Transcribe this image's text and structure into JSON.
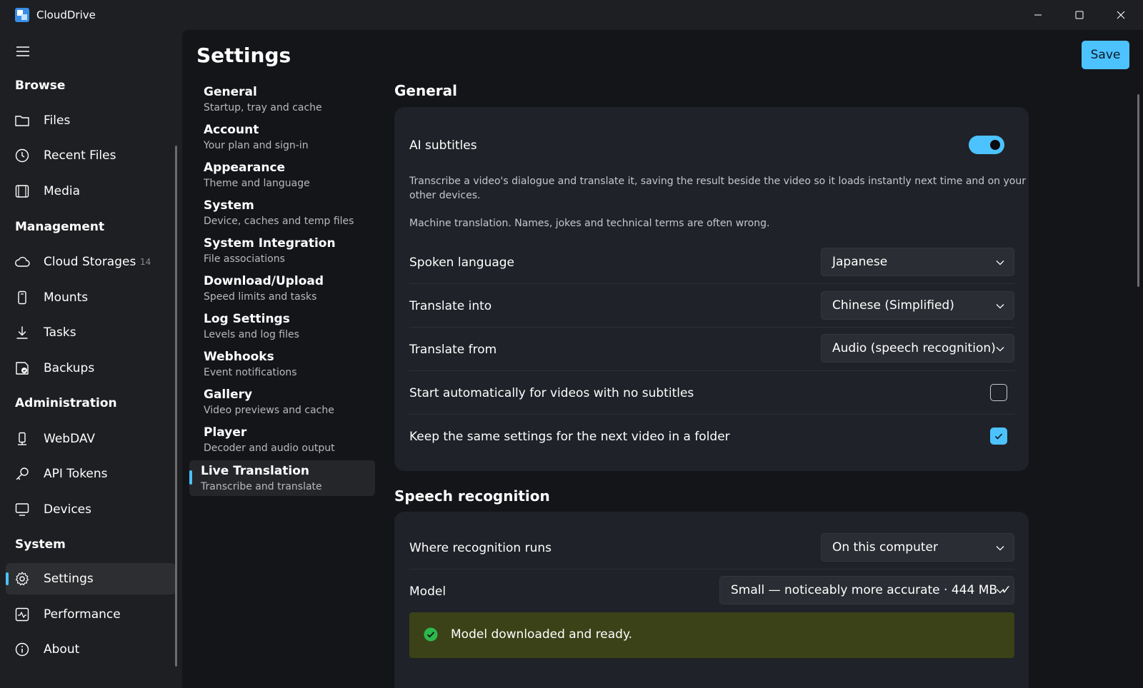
{
  "window": {
    "title": "CloudDrive",
    "controls": {
      "minimize": "minimize-icon",
      "maximize": "maximize-icon",
      "close": "close-icon"
    }
  },
  "colors": {
    "accent": "#4cc2ff",
    "banner_bg": "#3c4217",
    "success": "#2db84d"
  },
  "nav": {
    "sections": {
      "browse": "Browse",
      "management": "Management",
      "administration": "Administration",
      "system": "System"
    },
    "items": {
      "files": {
        "label": "Files",
        "icon": "folder-icon"
      },
      "recent": {
        "label": "Recent Files",
        "icon": "clock-icon"
      },
      "media": {
        "label": "Media",
        "icon": "film-icon"
      },
      "cloud": {
        "label": "Cloud Storages",
        "icon": "cloud-icon",
        "badge": "14"
      },
      "mounts": {
        "label": "Mounts",
        "icon": "drive-icon"
      },
      "tasks": {
        "label": "Tasks",
        "icon": "download-icon"
      },
      "backups": {
        "label": "Backups",
        "icon": "backup-icon"
      },
      "webdav": {
        "label": "WebDAV",
        "icon": "server-icon"
      },
      "tokens": {
        "label": "API Tokens",
        "icon": "key-icon"
      },
      "devices": {
        "label": "Devices",
        "icon": "monitor-icon"
      },
      "settings": {
        "label": "Settings",
        "icon": "gear-icon"
      },
      "performance": {
        "label": "Performance",
        "icon": "chart-icon"
      },
      "about": {
        "label": "About",
        "icon": "info-icon"
      }
    }
  },
  "page": {
    "title": "Settings",
    "save_label": "Save"
  },
  "subnav": [
    {
      "title": "General",
      "desc": "Startup, tray and cache"
    },
    {
      "title": "Account",
      "desc": "Your plan and sign-in"
    },
    {
      "title": "Appearance",
      "desc": "Theme and language"
    },
    {
      "title": "System",
      "desc": "Device, caches and temp files"
    },
    {
      "title": "System Integration",
      "desc": "File associations"
    },
    {
      "title": "Download/Upload",
      "desc": "Speed limits and tasks"
    },
    {
      "title": "Log Settings",
      "desc": "Levels and log files"
    },
    {
      "title": "Webhooks",
      "desc": "Event notifications"
    },
    {
      "title": "Gallery",
      "desc": "Video previews and cache"
    },
    {
      "title": "Player",
      "desc": "Decoder and audio output"
    },
    {
      "title": "Live Translation",
      "desc": "Transcribe and translate"
    }
  ],
  "general": {
    "title": "General",
    "ai_subtitles": {
      "label": "AI subtitles",
      "enabled": true,
      "desc_line1": "Transcribe a video's dialogue and translate it, saving the result beside the video so it loads instantly next time and on your",
      "desc_line2": "other devices.",
      "note": "Machine translation. Names, jokes and technical terms are often wrong."
    },
    "spoken_language": {
      "label": "Spoken language",
      "value": "Japanese"
    },
    "translate_into": {
      "label": "Translate into",
      "value": "Chinese (Simplified)"
    },
    "translate_from": {
      "label": "Translate from",
      "value": "Audio (speech recognition)"
    },
    "auto_start": {
      "label": "Start automatically for videos with no subtitles",
      "checked": false
    },
    "keep_settings": {
      "label": "Keep the same settings for the next video in a folder",
      "checked": true
    }
  },
  "speech": {
    "title": "Speech recognition",
    "where": {
      "label": "Where recognition runs",
      "value": "On this computer"
    },
    "model": {
      "label": "Model",
      "value": "Small — noticeably more accurate · 444 MB  ✓"
    },
    "status": "Model downloaded and ready."
  }
}
